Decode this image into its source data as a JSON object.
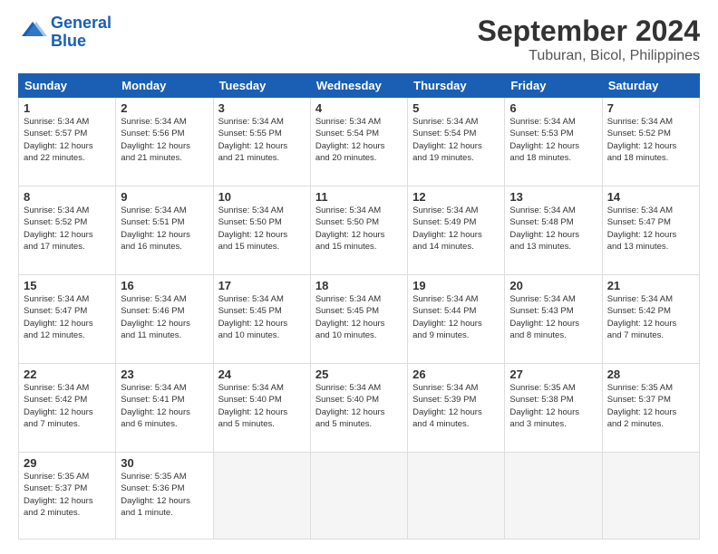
{
  "header": {
    "logo_line1": "General",
    "logo_line2": "Blue",
    "month": "September 2024",
    "location": "Tuburan, Bicol, Philippines"
  },
  "weekdays": [
    "Sunday",
    "Monday",
    "Tuesday",
    "Wednesday",
    "Thursday",
    "Friday",
    "Saturday"
  ],
  "weeks": [
    [
      {
        "day": "1",
        "info": "Sunrise: 5:34 AM\nSunset: 5:57 PM\nDaylight: 12 hours\nand 22 minutes."
      },
      {
        "day": "2",
        "info": "Sunrise: 5:34 AM\nSunset: 5:56 PM\nDaylight: 12 hours\nand 21 minutes."
      },
      {
        "day": "3",
        "info": "Sunrise: 5:34 AM\nSunset: 5:55 PM\nDaylight: 12 hours\nand 21 minutes."
      },
      {
        "day": "4",
        "info": "Sunrise: 5:34 AM\nSunset: 5:54 PM\nDaylight: 12 hours\nand 20 minutes."
      },
      {
        "day": "5",
        "info": "Sunrise: 5:34 AM\nSunset: 5:54 PM\nDaylight: 12 hours\nand 19 minutes."
      },
      {
        "day": "6",
        "info": "Sunrise: 5:34 AM\nSunset: 5:53 PM\nDaylight: 12 hours\nand 18 minutes."
      },
      {
        "day": "7",
        "info": "Sunrise: 5:34 AM\nSunset: 5:52 PM\nDaylight: 12 hours\nand 18 minutes."
      }
    ],
    [
      {
        "day": "8",
        "info": "Sunrise: 5:34 AM\nSunset: 5:52 PM\nDaylight: 12 hours\nand 17 minutes."
      },
      {
        "day": "9",
        "info": "Sunrise: 5:34 AM\nSunset: 5:51 PM\nDaylight: 12 hours\nand 16 minutes."
      },
      {
        "day": "10",
        "info": "Sunrise: 5:34 AM\nSunset: 5:50 PM\nDaylight: 12 hours\nand 15 minutes."
      },
      {
        "day": "11",
        "info": "Sunrise: 5:34 AM\nSunset: 5:50 PM\nDaylight: 12 hours\nand 15 minutes."
      },
      {
        "day": "12",
        "info": "Sunrise: 5:34 AM\nSunset: 5:49 PM\nDaylight: 12 hours\nand 14 minutes."
      },
      {
        "day": "13",
        "info": "Sunrise: 5:34 AM\nSunset: 5:48 PM\nDaylight: 12 hours\nand 13 minutes."
      },
      {
        "day": "14",
        "info": "Sunrise: 5:34 AM\nSunset: 5:47 PM\nDaylight: 12 hours\nand 13 minutes."
      }
    ],
    [
      {
        "day": "15",
        "info": "Sunrise: 5:34 AM\nSunset: 5:47 PM\nDaylight: 12 hours\nand 12 minutes."
      },
      {
        "day": "16",
        "info": "Sunrise: 5:34 AM\nSunset: 5:46 PM\nDaylight: 12 hours\nand 11 minutes."
      },
      {
        "day": "17",
        "info": "Sunrise: 5:34 AM\nSunset: 5:45 PM\nDaylight: 12 hours\nand 10 minutes."
      },
      {
        "day": "18",
        "info": "Sunrise: 5:34 AM\nSunset: 5:45 PM\nDaylight: 12 hours\nand 10 minutes."
      },
      {
        "day": "19",
        "info": "Sunrise: 5:34 AM\nSunset: 5:44 PM\nDaylight: 12 hours\nand 9 minutes."
      },
      {
        "day": "20",
        "info": "Sunrise: 5:34 AM\nSunset: 5:43 PM\nDaylight: 12 hours\nand 8 minutes."
      },
      {
        "day": "21",
        "info": "Sunrise: 5:34 AM\nSunset: 5:42 PM\nDaylight: 12 hours\nand 7 minutes."
      }
    ],
    [
      {
        "day": "22",
        "info": "Sunrise: 5:34 AM\nSunset: 5:42 PM\nDaylight: 12 hours\nand 7 minutes."
      },
      {
        "day": "23",
        "info": "Sunrise: 5:34 AM\nSunset: 5:41 PM\nDaylight: 12 hours\nand 6 minutes."
      },
      {
        "day": "24",
        "info": "Sunrise: 5:34 AM\nSunset: 5:40 PM\nDaylight: 12 hours\nand 5 minutes."
      },
      {
        "day": "25",
        "info": "Sunrise: 5:34 AM\nSunset: 5:40 PM\nDaylight: 12 hours\nand 5 minutes."
      },
      {
        "day": "26",
        "info": "Sunrise: 5:34 AM\nSunset: 5:39 PM\nDaylight: 12 hours\nand 4 minutes."
      },
      {
        "day": "27",
        "info": "Sunrise: 5:35 AM\nSunset: 5:38 PM\nDaylight: 12 hours\nand 3 minutes."
      },
      {
        "day": "28",
        "info": "Sunrise: 5:35 AM\nSunset: 5:37 PM\nDaylight: 12 hours\nand 2 minutes."
      }
    ],
    [
      {
        "day": "29",
        "info": "Sunrise: 5:35 AM\nSunset: 5:37 PM\nDaylight: 12 hours\nand 2 minutes."
      },
      {
        "day": "30",
        "info": "Sunrise: 5:35 AM\nSunset: 5:36 PM\nDaylight: 12 hours\nand 1 minute."
      },
      {
        "day": "",
        "info": ""
      },
      {
        "day": "",
        "info": ""
      },
      {
        "day": "",
        "info": ""
      },
      {
        "day": "",
        "info": ""
      },
      {
        "day": "",
        "info": ""
      }
    ]
  ]
}
